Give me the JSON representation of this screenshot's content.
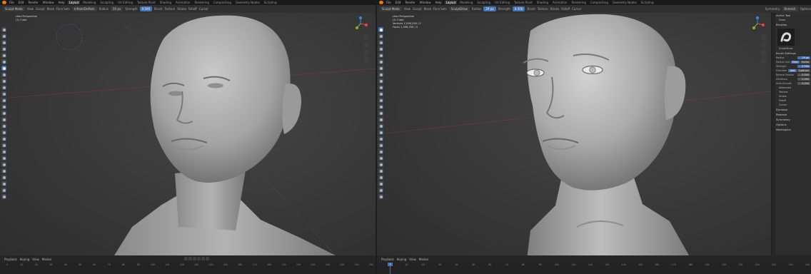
{
  "left": {
    "menu": [
      "File",
      "Edit",
      "Render",
      "Window",
      "Help"
    ],
    "workspaces": [
      "Layout",
      "Modeling",
      "Sculpting",
      "UV Editing",
      "Texture Paint",
      "Shading",
      "Animation",
      "Rendering",
      "Compositing",
      "Geometry Nodes",
      "Scripting"
    ],
    "active_workspace": "Layout",
    "mode": "Sculpt Mode",
    "header_items": [
      "View",
      "Sculpt",
      "Mask",
      "Face Sets"
    ],
    "brush_name": "Inflate/Deflate",
    "radius_label": "Radius",
    "radius_value": "50 px",
    "strength_label": "Strength",
    "strength_value": "0.500",
    "header_right": [
      "Brush",
      "Texture",
      "Stroke",
      "Falloff",
      "Cursor"
    ],
    "viewport_info": [
      "User Perspective",
      "(1) Cube"
    ],
    "bottom_items": [
      "Playback",
      "Keying",
      "View",
      "Marker"
    ],
    "ticks": [
      "0",
      "10",
      "20",
      "30",
      "40",
      "50",
      "60",
      "70",
      "80",
      "90",
      "100",
      "110",
      "120",
      "130",
      "140",
      "150",
      "160",
      "170",
      "180",
      "190",
      "200",
      "210",
      "220",
      "230",
      "240",
      "250"
    ]
  },
  "right": {
    "menu": [
      "File",
      "Edit",
      "Render",
      "Window",
      "Help"
    ],
    "workspaces": [
      "Layout",
      "Modeling",
      "Sculpting",
      "UV Editing",
      "Texture Paint",
      "Shading",
      "Animation",
      "Rendering",
      "Compositing",
      "Geometry Nodes",
      "Scripting"
    ],
    "active_workspace": "Layout",
    "mode": "Sculpt Mode",
    "header_items": [
      "View",
      "Sculpt",
      "Mask",
      "Face Sets"
    ],
    "brush_name": "SculptDraw",
    "radius_label": "Radius",
    "radius_value": "29 px",
    "strength_label": "Strength",
    "strength_value": "0.500",
    "header_right": [
      "Brush",
      "Texture",
      "Stroke",
      "Falloff",
      "Cursor"
    ],
    "header_far_right": [
      "Symmetry",
      "Remesh",
      "Options"
    ],
    "viewport_info": [
      "User Perspective",
      "(1) Cube",
      "Vertices   1,096,256 / 0",
      "Faces      1,096,256 / 0"
    ],
    "bottom_items": [
      "Playback",
      "Keying",
      "View",
      "Marker"
    ],
    "current_frame": "1",
    "ticks": [
      "0",
      "10",
      "20",
      "30",
      "40",
      "50",
      "60",
      "70",
      "80",
      "90",
      "100",
      "110",
      "120",
      "130",
      "140",
      "150",
      "160",
      "170",
      "180",
      "190",
      "200",
      "210",
      "220",
      "230",
      "240",
      "250"
    ],
    "props": {
      "active_tool": "Active Tool",
      "tool_name": "Draw",
      "brushes": "Brushes",
      "brush_thumb_label": "SculptDraw",
      "brush_settings": "Brush Settings",
      "radius_label": "Radius",
      "radius_value": "29 px",
      "radius_unit_label": "Radius Unit",
      "radius_unit_values": [
        "View",
        "Scene"
      ],
      "strength_label": "Strength",
      "strength_value": "0.500",
      "direction_label": "Direction",
      "direction_values": [
        "Add",
        "Subtract"
      ],
      "normal_radius_label": "Normal Radius",
      "normal_radius_value": "0.500",
      "hardness_label": "Hardness",
      "hardness_value": "0.000",
      "auto_smooth_label": "Auto-Smooth",
      "auto_smooth_value": "0.000",
      "subpanels": [
        "Advanced",
        "Texture",
        "Stroke",
        "Falloff",
        "Cursor"
      ],
      "sections": [
        "Dyntopo",
        "Remesh",
        "Symmetry",
        "Options",
        "Workspace"
      ]
    }
  }
}
